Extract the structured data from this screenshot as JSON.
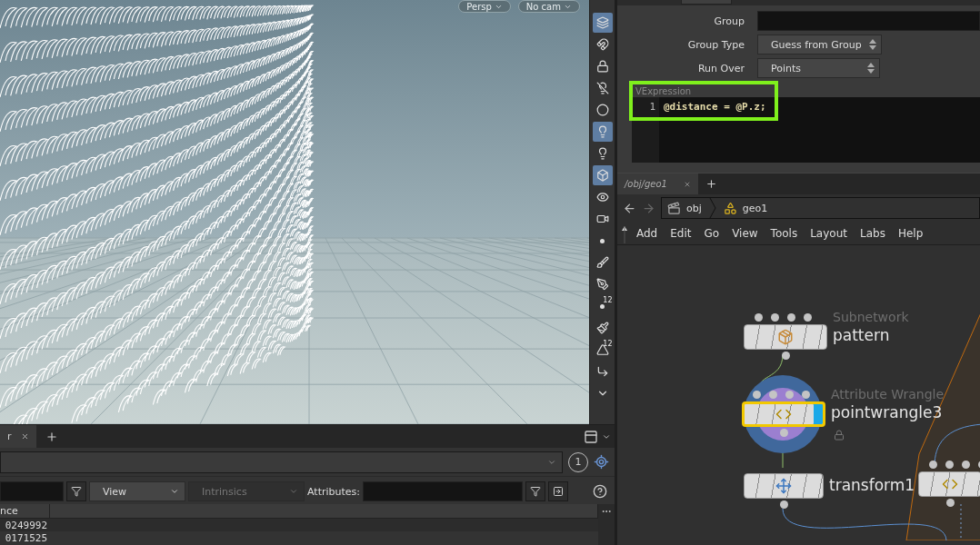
{
  "viewport": {
    "camera_menus": [
      {
        "label": "Persp"
      },
      {
        "label": "No cam"
      }
    ]
  },
  "viewport_toolbar": [
    {
      "kind": "display-options",
      "active": true
    },
    {
      "kind": "snap",
      "active": false
    },
    {
      "kind": "lock",
      "active": false
    },
    {
      "kind": "light-off",
      "active": false
    },
    {
      "kind": "sphere",
      "active": false
    },
    {
      "kind": "light",
      "active": true
    },
    {
      "kind": "light-add",
      "active": false
    },
    {
      "kind": "cube",
      "active": true
    },
    {
      "kind": "eye",
      "active": false
    },
    {
      "kind": "camera",
      "active": false
    },
    {
      "kind": "point",
      "active": false
    },
    {
      "kind": "brush",
      "active": false
    },
    {
      "kind": "pen",
      "active": false
    },
    {
      "kind": "point-number",
      "active": false,
      "badge": "12"
    },
    {
      "kind": "paint",
      "active": false
    },
    {
      "kind": "prim-number",
      "active": false,
      "badge": "12"
    },
    {
      "kind": "edge",
      "active": false
    },
    {
      "kind": "more",
      "active": false
    }
  ],
  "spreadsheet": {
    "tabs": [
      {
        "label": "r",
        "selected": true
      }
    ],
    "node_count": "1",
    "filter_bar": {
      "view_menu": "View",
      "intrinsics_menu": {
        "label": "Intrinsics",
        "disabled": true
      },
      "attributes_label": "Attributes:"
    },
    "table": {
      "columns": [
        "nce"
      ],
      "rows": [
        [
          "0249992"
        ],
        [
          "0171525"
        ]
      ]
    }
  },
  "parameters": {
    "rows": [
      {
        "label": "Group",
        "kind": "text"
      },
      {
        "label": "Group Type",
        "kind": "menu",
        "value": "Guess from Group"
      },
      {
        "label": "Run Over",
        "kind": "menu",
        "value": "Points"
      }
    ],
    "vexpression": {
      "label": "VExpression",
      "highlighted": true,
      "lines": [
        {
          "number": "1",
          "code": "@distance = @P.z;"
        }
      ]
    }
  },
  "network": {
    "tabs": [
      {
        "label": "/obj/geo1",
        "selected": true
      }
    ],
    "path": [
      {
        "kind": "object",
        "label": "obj"
      },
      {
        "kind": "geometry",
        "label": "geo1"
      }
    ],
    "menu": [
      "Add",
      "Edit",
      "Go",
      "View",
      "Tools",
      "Layout",
      "Labs",
      "Help"
    ],
    "nodes": [
      {
        "kind": "subnet",
        "type": "Subnetwork",
        "name": "pattern",
        "selected": false,
        "display": false
      },
      {
        "kind": "wrangle",
        "type": "Attribute Wrangle",
        "name": "pointwrangle3",
        "selected": true,
        "display": true,
        "locked": true
      },
      {
        "kind": "transform",
        "name": "transform1",
        "selected": false,
        "display": false
      },
      {
        "kind": "wrangle",
        "selected": false,
        "display": false
      }
    ]
  }
}
